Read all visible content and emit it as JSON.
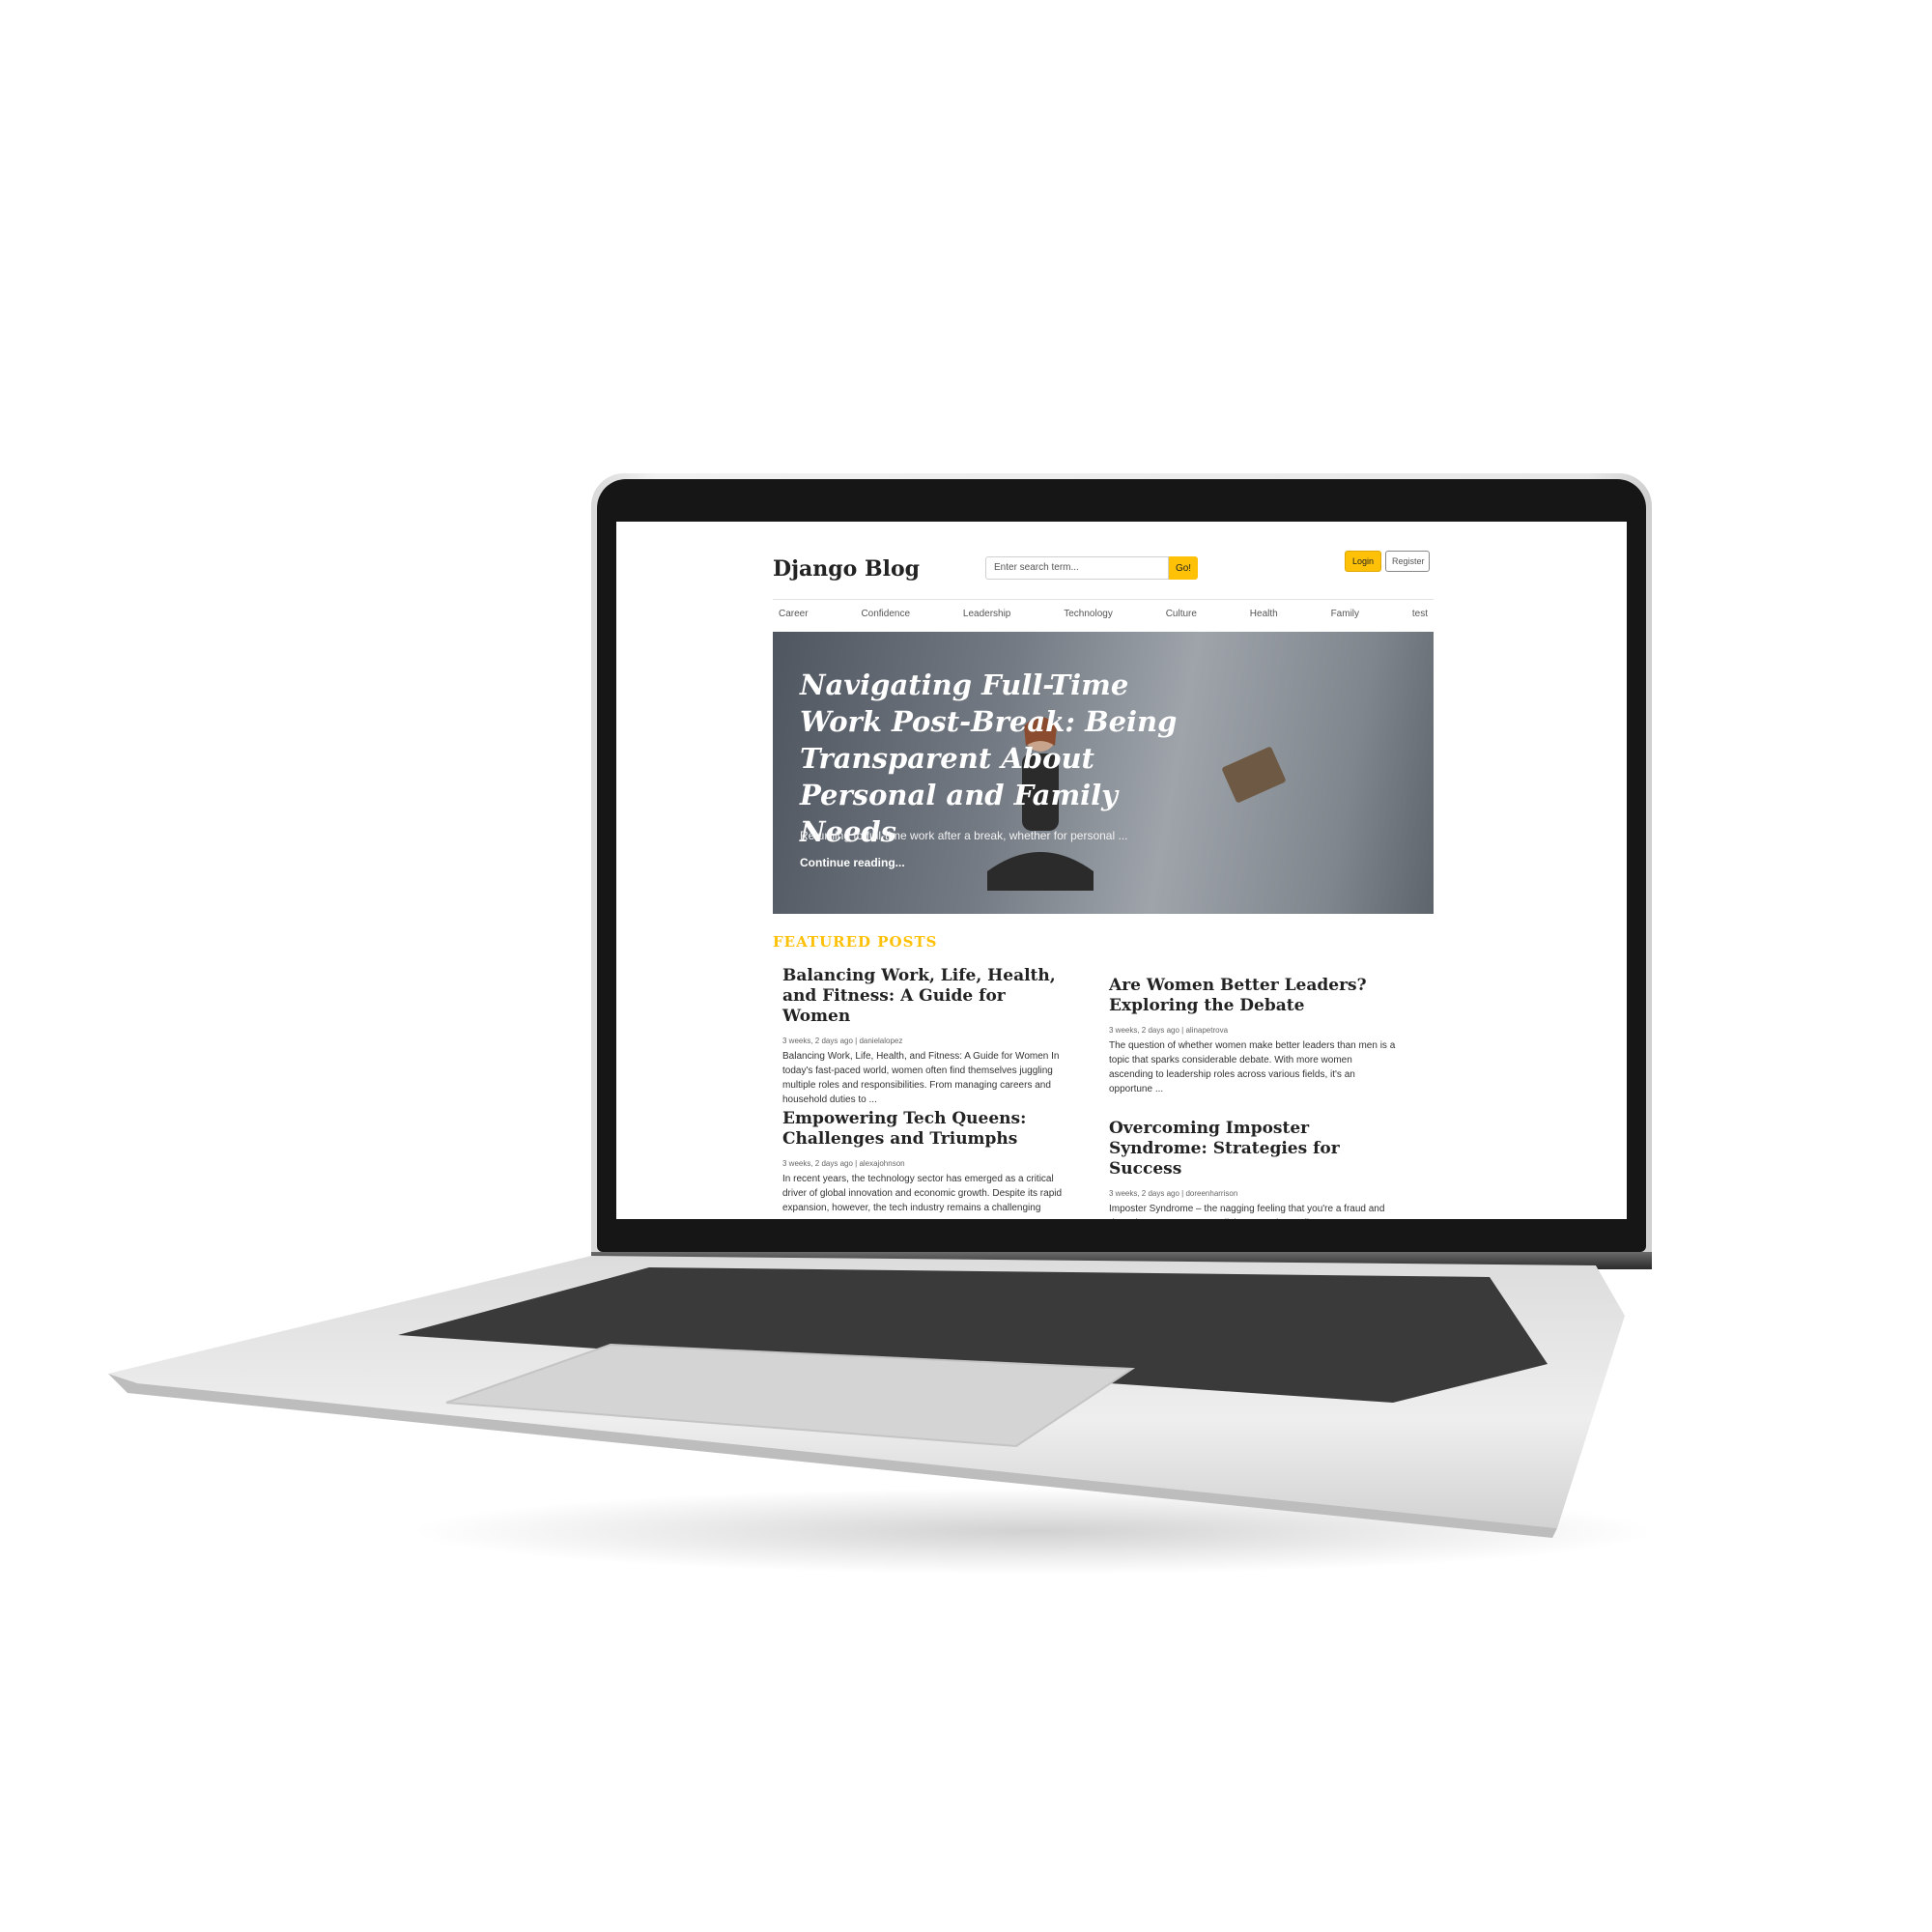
{
  "blog": {
    "brand": "Django Blog",
    "search_placeholder": "Enter search term...",
    "go_label": "Go!",
    "login_label": "Login",
    "register_label": "Register",
    "nav": [
      "Career",
      "Confidence",
      "Leadership",
      "Technology",
      "Culture",
      "Health",
      "Family",
      "test"
    ],
    "hero": {
      "title": "Navigating Full-Time Work Post-Break: Being Transparent About Personal and Family Needs",
      "excerpt": "Returning to full-time work after a break, whether for personal ...",
      "link": "Continue reading..."
    },
    "featured_heading": "FEATURED POSTS",
    "posts": [
      {
        "title": "Balancing Work, Life, Health, and Fitness: A Guide for Women",
        "meta": "3 weeks, 2 days ago | danielalopez",
        "excerpt": "Balancing Work, Life, Health, and Fitness: A Guide for Women In today's fast-paced world, women often find themselves juggling multiple roles and responsibilities. From managing careers and household duties to ..."
      },
      {
        "title": "Are Women Better Leaders? Exploring the Debate",
        "meta": "3 weeks, 2 days ago | alinapetrova",
        "excerpt": "The question of whether women make better leaders than men is a topic that sparks considerable debate. With more women ascending to leadership roles across various fields, it's an opportune ..."
      },
      {
        "title": "Empowering Tech Queens: Challenges and Triumphs",
        "meta": "3 weeks, 2 days ago | alexajohnson",
        "excerpt": "In recent years, the technology sector has emerged as a critical driver of global innovation and economic growth. Despite its rapid expansion, however, the tech industry remains a challenging"
      },
      {
        "title": "Overcoming Imposter Syndrome: Strategies for Success",
        "meta": "3 weeks, 2 days ago | doreenharrison",
        "excerpt": "Imposter Syndrome – the nagging feeling that you're a fraud and don't deserve your accomplishments – is an all-too-common experience among high achievers. Whether you're a seasoned"
      }
    ]
  },
  "colors": {
    "accent": "#ffc107",
    "text": "#222222",
    "laptop_body": "#e6e6e6",
    "bezel": "#161616"
  }
}
